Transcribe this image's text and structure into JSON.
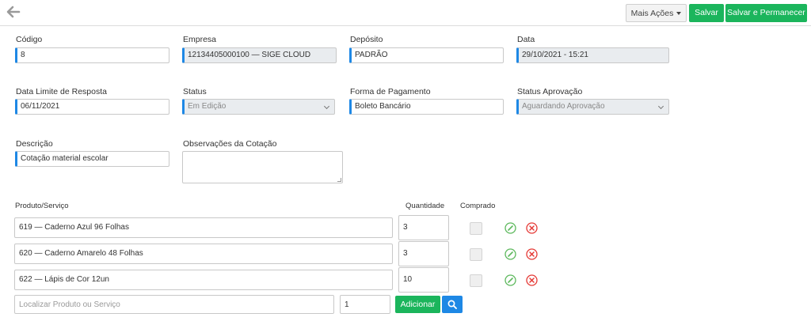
{
  "toolbar": {
    "more_actions_label": "Mais Ações",
    "save_label": "Salvar",
    "save_stay_label": "Salvar e Permanecer"
  },
  "form": {
    "codigo": {
      "label": "Código",
      "value": "8"
    },
    "empresa": {
      "label": "Empresa",
      "value": "12134405000100 — SIGE CLOUD"
    },
    "deposito": {
      "label": "Depósito",
      "value": "PADRÃO"
    },
    "data": {
      "label": "Data",
      "value": "29/10/2021 - 15:21"
    },
    "data_limite": {
      "label": "Data Limite de Resposta",
      "value": "06/11/2021"
    },
    "status": {
      "label": "Status",
      "value": "Em Edição"
    },
    "forma_pagamento": {
      "label": "Forma de Pagamento",
      "value": "Boleto Bancário"
    },
    "status_aprovacao": {
      "label": "Status Aprovação",
      "value": "Aguardando Aprovação"
    },
    "descricao": {
      "label": "Descrição",
      "value": "Cotação material escolar"
    },
    "observacoes": {
      "label": "Observações da Cotação",
      "value": ""
    }
  },
  "items": {
    "headers": {
      "product": "Produto/Serviço",
      "quantity": "Quantidade",
      "purchased": "Comprado"
    },
    "rows": [
      {
        "product": "619 — Caderno Azul 96 Folhas",
        "quantity": "3",
        "purchased": false
      },
      {
        "product": "620 — Caderno Amarelo 48 Folhas",
        "quantity": "3",
        "purchased": false
      },
      {
        "product": "622 — Lápis de Cor 12un",
        "quantity": "10",
        "purchased": false
      }
    ],
    "add": {
      "search_placeholder": "Localizar Produto ou Serviço",
      "quantity_value": "1",
      "add_label": "Adicionar"
    }
  },
  "colors": {
    "primary_green": "#1bb55c",
    "accent_blue": "#1e88e5",
    "edit_green": "#5cb85c",
    "delete_red": "#e53935"
  },
  "icons": {
    "back": "arrow-left-icon",
    "edit": "pencil-circle-icon",
    "delete": "x-circle-icon",
    "search": "magnifier-icon"
  }
}
